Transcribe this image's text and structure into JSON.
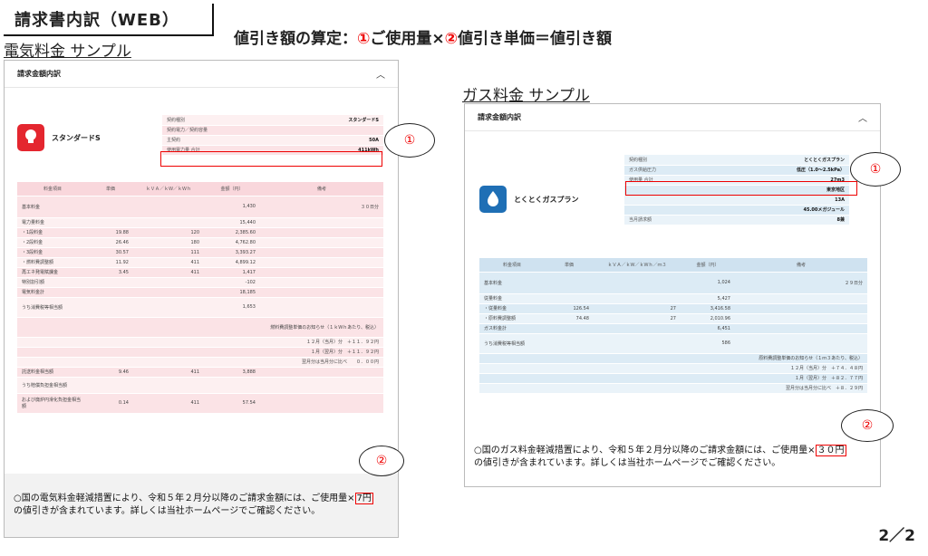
{
  "header": {
    "title": "請求書内訳（WEB）",
    "formula_prefix": "値引き額の算定：",
    "formula_mark1": "①",
    "formula_part1": "ご使用量×",
    "formula_mark2": "②",
    "formula_part2": "値引き単価＝値引き額"
  },
  "electric": {
    "section_label": "電気料金 サンプル",
    "panel_title": "請求金額内訳",
    "plan_icon_text": "スタンダードS",
    "plan_name": "スタンダードS",
    "contract": [
      {
        "k": "契約種別",
        "v": "スタンダードS"
      },
      {
        "k": "契約電力／契約容量",
        "v": ""
      },
      {
        "k": "主契約",
        "v": "50A"
      },
      {
        "k": "使用電力量 合計",
        "v": "411kWh"
      }
    ],
    "headers": [
      "料金項目",
      "単価",
      "ｋＶＡ／ｋＷ／ｋＷｈ",
      "金額（円）",
      "備考"
    ],
    "rows": [
      [
        "基本料金",
        "",
        "",
        "1,430",
        "３０日分"
      ],
      [
        "電力量料金",
        "",
        "",
        "15,440",
        ""
      ],
      [
        "・1段料金",
        "19.88",
        "120",
        "2,385.60",
        ""
      ],
      [
        "・2段料金",
        "26.46",
        "180",
        "4,762.80",
        ""
      ],
      [
        "・3段料金",
        "30.57",
        "111",
        "3,393.27",
        ""
      ],
      [
        "・燃料費調整額",
        "11.92",
        "411",
        "4,899.12",
        ""
      ],
      [
        "再エネ発電賦課金",
        "3.45",
        "411",
        "1,417",
        ""
      ],
      [
        "特別割引額",
        "",
        "",
        "-102",
        ""
      ],
      [
        "電気料金計",
        "",
        "",
        "18,185",
        ""
      ],
      [
        "うち消費税等相当額",
        "",
        "",
        "1,653",
        ""
      ],
      [
        "",
        "",
        "",
        "",
        "燃料費調整単価のお知らせ（１ｋＷｈあたり、税込）"
      ],
      [
        "",
        "",
        "",
        "",
        "１２月（当月）分　＋１１．９２円"
      ],
      [
        "",
        "",
        "",
        "",
        "１月（翌月）分　＋１１．９２円"
      ],
      [
        "",
        "",
        "",
        "",
        "翌月分は当月分に比べ　　０．００円"
      ],
      [
        "託送料金相当額",
        "9.46",
        "411",
        "3,888",
        ""
      ],
      [
        "うち賠償負担金相当額",
        "",
        "",
        "",
        ""
      ],
      [
        "および廃炉円滑化負担金相当額",
        "0.14",
        "411",
        "57.54",
        ""
      ]
    ],
    "note_line1_pre": "○国の電気料金軽減措置により、令和５年２月分以降のご請求金額には、ご使用量×",
    "note_amount": "7円",
    "note_line2": "の値引きが含まれています。詳しくは当社ホームページでご確認ください。"
  },
  "gas": {
    "section_label": "ガス料金 サンプル",
    "panel_title": "請求金額内訳",
    "plan_icon_text": "ガス",
    "plan_name": "とくとくガスプラン",
    "contract": [
      {
        "k": "契約種別",
        "v": "とくとくガスプラン"
      },
      {
        "k": "ガス供給圧力",
        "v": "低圧（1.0〜2.5kPa）"
      },
      {
        "k": "使用量 合計",
        "v": "27m3"
      },
      {
        "k": "",
        "v": "東京地区"
      },
      {
        "k": "",
        "v": "13A"
      },
      {
        "k": "",
        "v": "45.00メガジュール"
      },
      {
        "k": "当月請求額",
        "v": "8兼"
      }
    ],
    "headers": [
      "料金項目",
      "単価",
      "ｋＶＡ／ｋＷ／ｋＷｈ／ｍ３",
      "金額（円）",
      "備考"
    ],
    "rows": [
      [
        "基本料金",
        "",
        "",
        "1,024",
        "２９日分"
      ],
      [
        "従量料金",
        "",
        "",
        "5,427",
        ""
      ],
      [
        "・従量料金",
        "126.54",
        "27",
        "3,416.58",
        ""
      ],
      [
        "・原料費調整額",
        "74.48",
        "27",
        "2,010.96",
        ""
      ],
      [
        "ガス料金計",
        "",
        "",
        "6,451",
        ""
      ],
      [
        "うち消費税等相当額",
        "",
        "",
        "586",
        ""
      ],
      [
        "",
        "",
        "",
        "",
        "原料費調整単価のお知らせ（１ｍ３あたり、税込）"
      ],
      [
        "",
        "",
        "",
        "",
        "１２月（当月）分　＋７４．４８円"
      ],
      [
        "",
        "",
        "",
        "",
        "１月（翌月）分　＋８２．７７円"
      ],
      [
        "",
        "",
        "",
        "",
        "翌月分は当月分に比べ　＋８．２９円"
      ]
    ],
    "note_line1_pre": "○国のガス料金軽減措置により、令和５年２月分以降のご請求金額には、ご使用量×",
    "note_amount": "３０円",
    "note_line2": "の値引きが含まれています。詳しくは当社ホームページでご確認ください。"
  },
  "markers": {
    "one": "①",
    "two": "②"
  },
  "page_number": "2／2",
  "colors": {
    "accent_red": "#e00000",
    "electric_pink": "#f9d7dc",
    "gas_blue": "#cfe2f0",
    "electric_icon": "#e4262f",
    "gas_icon": "#1f6fb5"
  },
  "icons": {
    "collapse": "chevron-up-icon",
    "electric_plan": "lightbulb-icon",
    "gas_plan": "flame-icon"
  }
}
